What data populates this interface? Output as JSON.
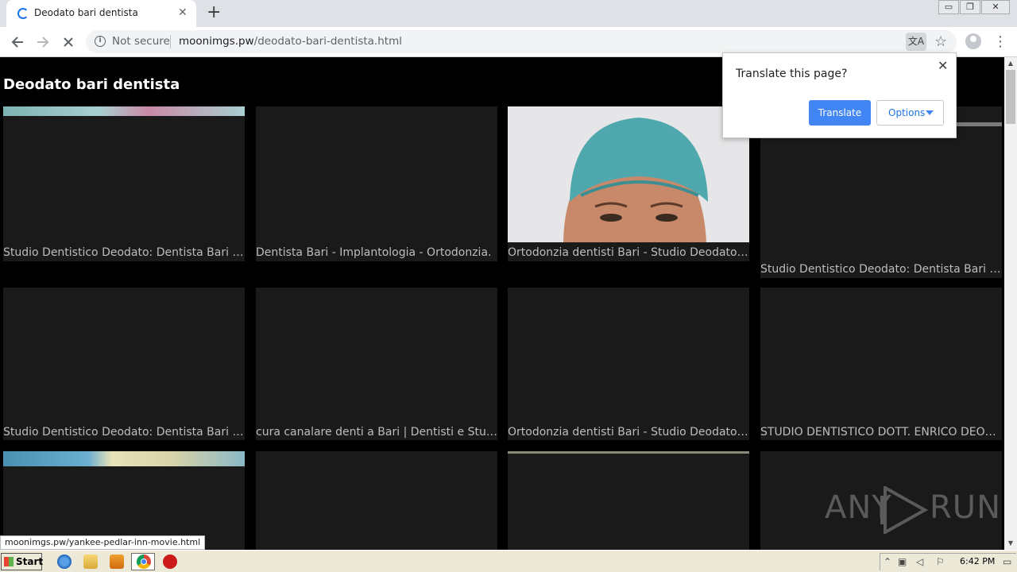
{
  "browser": {
    "tab_title": "Deodato bari dentista",
    "tab_close": "✕",
    "new_tab": "+",
    "security_label": "Not secure",
    "url_host": "moonimgs.pw",
    "url_path": "/deodato-bari-dentista.html",
    "window_buttons": [
      "▭",
      "❐",
      "✕"
    ]
  },
  "page": {
    "title": "Deodato bari dentista",
    "cards": [
      {
        "caption": "Studio Dentistico Deodato: Dentista Bari | E..."
      },
      {
        "caption": "Dentista Bari - Implantologia - Ortodonzia."
      },
      {
        "caption": "Ortodonzia dentisti Bari - Studio Deodato B..."
      },
      {
        "caption": "Studio Dentistico Deodato: Dentista Bari | E..."
      },
      {
        "caption": "Studio Dentistico Deodato: Dentista Bari | E..."
      },
      {
        "caption": "cura canalare denti a Bari | Dentisti e Studi ..."
      },
      {
        "caption": "Ortodonzia dentisti Bari - Studio Deodato B..."
      },
      {
        "caption": "STUDIO DENTISTICO DOTT. ENRICO DEOD..."
      }
    ]
  },
  "translate_bubble": {
    "question": "Translate this page?",
    "translate_label": "Translate",
    "options_label": "Options",
    "close": "✕"
  },
  "status_url": "moonimgs.pw/yankee-pedlar-inn-movie.html",
  "watermark": {
    "left": "ANY",
    "right": "RUN"
  },
  "taskbar": {
    "start_label": "Start",
    "clock": "6:42 PM"
  },
  "colors": {
    "accent": "#4285f4",
    "page_bg": "#000000",
    "card_bg": "#1a1a1a",
    "caption": "#bdbdbd"
  }
}
